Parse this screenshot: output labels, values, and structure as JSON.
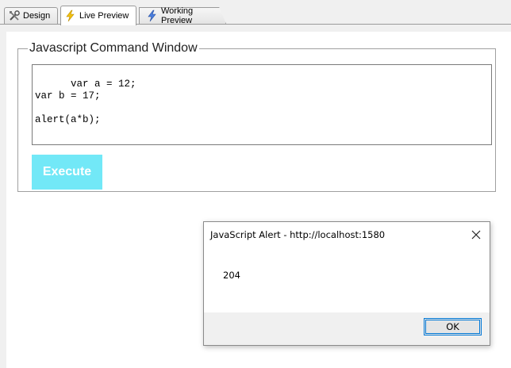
{
  "tabs": [
    {
      "label": "Design",
      "icon": "tools-icon"
    },
    {
      "label": "Live Preview",
      "icon": "lightning-icon"
    },
    {
      "label": "Working Preview",
      "icon": "lightning-icon"
    }
  ],
  "command_window": {
    "legend": "Javascript Command Window",
    "code": "var a = 12;\nvar b = 17;\n\nalert(a*b);",
    "execute_label": "Execute",
    "execute_color": "#72e8f7"
  },
  "alert": {
    "title": "JavaScript Alert - http://localhost:1580",
    "message": "204",
    "ok_label": "OK",
    "close_icon": "close-icon",
    "accent": "#0078d7"
  }
}
